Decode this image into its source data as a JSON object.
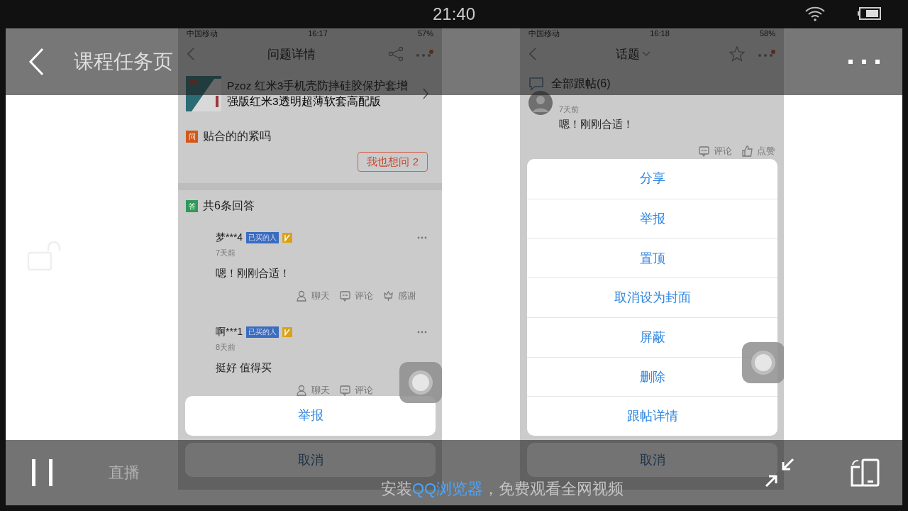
{
  "status_bar": {
    "time": "21:40"
  },
  "top_bar": {
    "title": "课程任务页"
  },
  "video": {
    "screens": [
      {
        "kind": "question",
        "status": {
          "carrier": "中国移动",
          "time": "16:17",
          "battery": "57%"
        },
        "nav_title": "问题详情",
        "product": {
          "title": "Pzoz 红米3手机壳防摔硅胶保护套增强版红米3透明超薄软套高配版"
        },
        "question": {
          "badge": "问",
          "text": "贴合的的紧吗"
        },
        "ask_button": "我也想问 2",
        "answers_header": {
          "badge": "答",
          "text": "共6条回答"
        },
        "answers": [
          {
            "user": "梦***4",
            "tag": "已买的人",
            "time": "7天前",
            "text": "嗯！刚刚合适！",
            "actions": [
              {
                "kind": "chat",
                "label": "聊天"
              },
              {
                "kind": "comment",
                "label": "评论"
              },
              {
                "kind": "thanks",
                "label": "感谢"
              }
            ]
          },
          {
            "user": "啊***1",
            "tag": "已买的人",
            "time": "8天前",
            "text": "挺好 值得买",
            "actions": [
              {
                "kind": "chat",
                "label": "聊天"
              },
              {
                "kind": "comment",
                "label": "评论"
              }
            ]
          }
        ],
        "sheet": {
          "options": [
            "举报"
          ],
          "cancel": "取消"
        }
      },
      {
        "kind": "topic",
        "status": {
          "carrier": "中国移动",
          "time": "16:18",
          "battery": "58%"
        },
        "nav_title": "话题",
        "section": "全部跟帖(6)",
        "posts": [
          {
            "time": "7天前",
            "text": "嗯！刚刚合适！",
            "actions": [
              {
                "kind": "comment",
                "label": "评论"
              },
              {
                "kind": "like",
                "label": "点赞"
              }
            ]
          }
        ],
        "sheet": {
          "options": [
            "分享",
            "举报",
            "置顶",
            "取消设为封面",
            "屏蔽",
            "删除",
            "跟帖详情"
          ],
          "cancel": "取消"
        }
      }
    ]
  },
  "controls": {
    "live": "直播",
    "promo": {
      "before": "安装",
      "link": "QQ浏览器",
      "after": "，免费观看全网视频"
    }
  }
}
